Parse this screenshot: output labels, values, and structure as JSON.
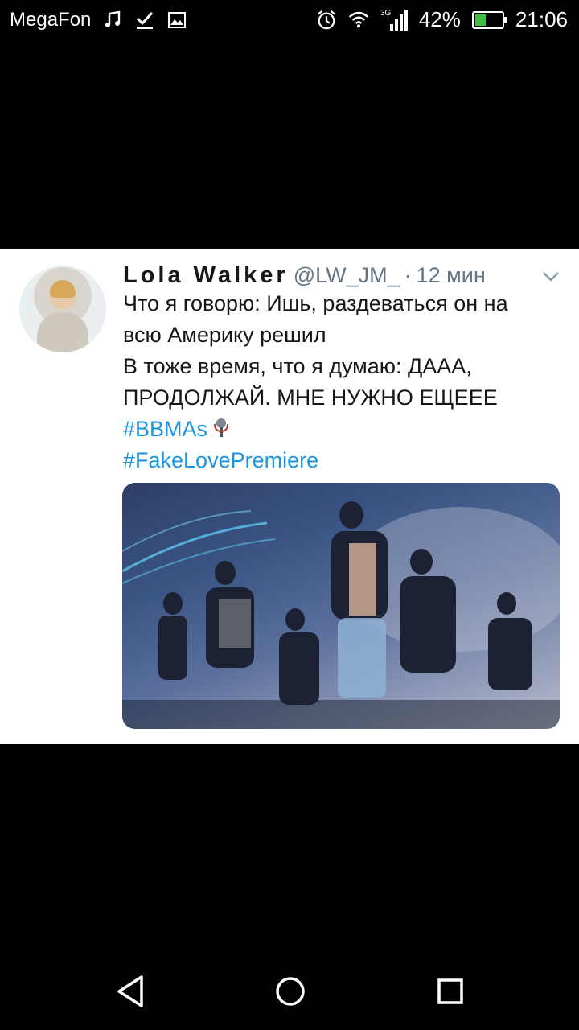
{
  "status_bar": {
    "carrier": "MegaFon",
    "battery_percent": "42%",
    "battery_level": 0.42,
    "time": "21:06",
    "network": "3G",
    "icons": [
      "music-icon",
      "download-done-icon",
      "image-icon",
      "alarm-icon",
      "wifi-icon",
      "signal-icon",
      "battery-charging-icon"
    ]
  },
  "tweet": {
    "author_name": "Lola Walker",
    "handle": "@LW_JM_",
    "separator": "·",
    "time_ago": "12 мин",
    "lines": [
      "Что я говорю: Ишь, раздеваться он на",
      "всю Америку решил",
      "В тоже время, что я думаю: ДААА,",
      "ПРОДОЛЖАЙ. МНЕ НУЖНО ЕЩЕЕЕ"
    ],
    "hashtags": [
      "#BBMAs",
      "#FakeLovePremiere"
    ],
    "colors": {
      "hashtag": "#1b95e0",
      "meta": "#657786",
      "text": "#14171a"
    }
  },
  "nav_bar": {
    "icons": [
      "back-icon",
      "home-icon",
      "recents-icon"
    ]
  }
}
